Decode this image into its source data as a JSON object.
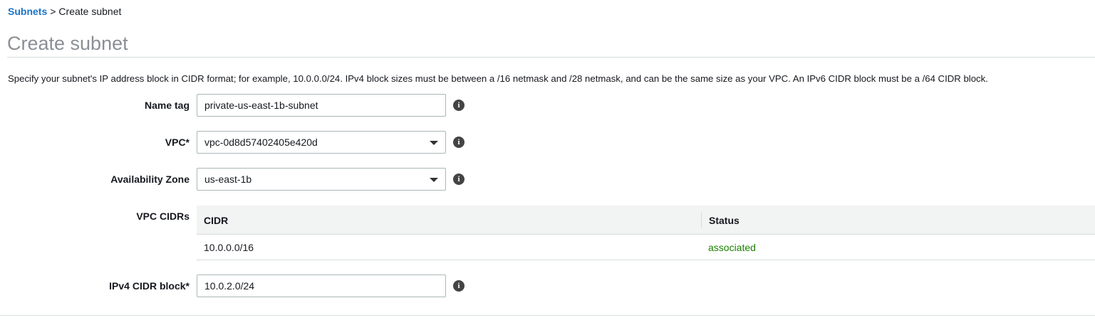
{
  "breadcrumb": {
    "parent": "Subnets",
    "separator": ">",
    "current": "Create subnet"
  },
  "page": {
    "title": "Create subnet",
    "description": "Specify your subnet's IP address block in CIDR format; for example, 10.0.0.0/24. IPv4 block sizes must be between a /16 netmask and /28 netmask, and can be the same size as your VPC. An IPv6 CIDR block must be a /64 CIDR block."
  },
  "form": {
    "name_tag": {
      "label": "Name tag",
      "value": "private-us-east-1b-subnet"
    },
    "vpc": {
      "label": "VPC*",
      "value": "vpc-0d8d57402405e420d"
    },
    "availability_zone": {
      "label": "Availability Zone",
      "value": "us-east-1b"
    },
    "vpc_cidrs": {
      "label": "VPC CIDRs",
      "columns": [
        "CIDR",
        "Status"
      ],
      "rows": [
        {
          "cidr": "10.0.0.0/16",
          "status": "associated"
        }
      ]
    },
    "ipv4_cidr": {
      "label": "IPv4 CIDR block*",
      "value": "10.0.2.0/24"
    }
  },
  "icons": {
    "info": "i"
  },
  "colors": {
    "link": "#1a73c8",
    "status_ok": "#1d8102",
    "title": "#8a8f96"
  }
}
